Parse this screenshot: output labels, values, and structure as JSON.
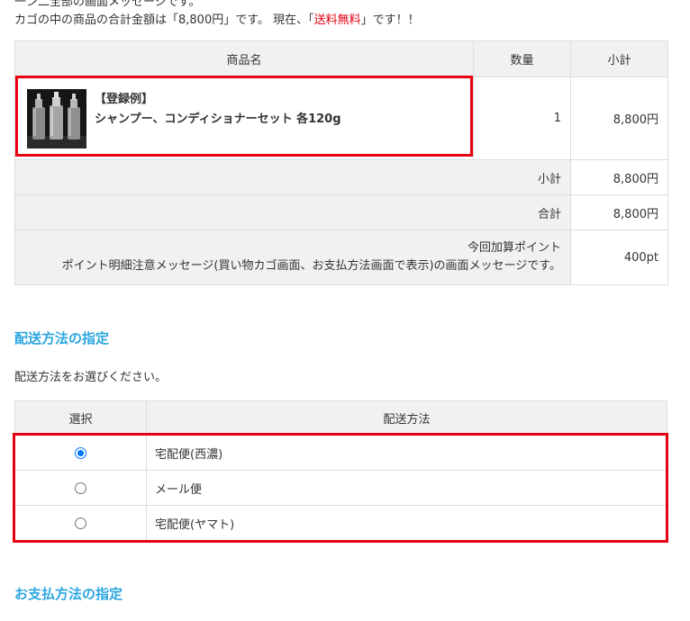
{
  "top_fragment": "一ン二全部の画面メッセージです。",
  "total_message": {
    "before": "カゴの中の商品の合計金額は「8,800円」です。 現在、「",
    "highlight": "送料無料",
    "after": "」です！！"
  },
  "cart": {
    "headers": {
      "name": "商品名",
      "qty": "数量",
      "subtotal": "小計"
    },
    "item": {
      "name_line1": "【登録例】",
      "name_line2": "シャンプー、コンディショナーセット 各120g",
      "qty": "1",
      "price": "8,800円"
    },
    "subtotal_label": "小計",
    "subtotal_value": "8,800円",
    "total_label": "合計",
    "total_value": "8,800円",
    "point_label": "今回加算ポイント",
    "point_message": "ポイント明細注意メッセージ(買い物カゴ画面、お支払方法画面で表示)の画面メッセージです。",
    "point_value": "400pt"
  },
  "shipping": {
    "title": "配送方法の指定",
    "lead": "配送方法をお選びください。",
    "headers": {
      "select": "選択",
      "method": "配送方法"
    },
    "options": [
      {
        "label": "宅配便(西濃)",
        "selected": true
      },
      {
        "label": "メール便",
        "selected": false
      },
      {
        "label": "宅配便(ヤマト)",
        "selected": false
      }
    ]
  },
  "payment": {
    "title": "お支払方法の指定"
  },
  "colors": {
    "accent": "#2ba6e1",
    "highlight_border": "#e60012",
    "free_shipping_text": "#e60012",
    "radio_checked": "#0075ff"
  }
}
